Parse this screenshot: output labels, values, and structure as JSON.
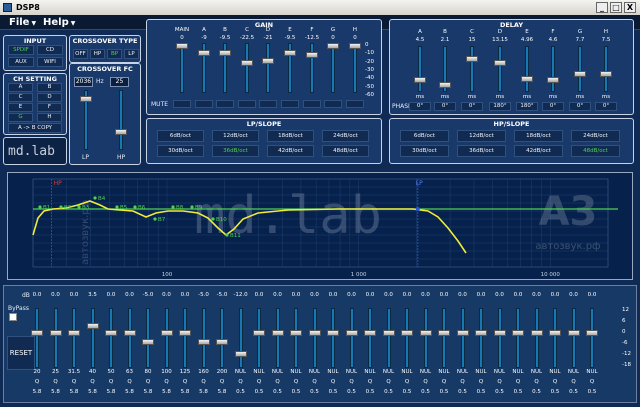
{
  "window": {
    "title": "DSP8",
    "minimize": "_",
    "maximize": "□",
    "close": "X"
  },
  "menu": [
    {
      "label": "File"
    },
    {
      "label": "Help"
    }
  ],
  "input": {
    "title": "INPUT",
    "buttons": [
      "SPDIF",
      "CD",
      "AUX",
      "WIFI"
    ],
    "active": "SPDIF"
  },
  "ch_setting": {
    "title": "CH SETTING",
    "buttons": [
      "A",
      "B",
      "C",
      "D",
      "E",
      "F",
      "G",
      "H"
    ],
    "active": "G",
    "copy": "A -> B COPY"
  },
  "logo": "md.lab",
  "crossover_type": {
    "title": "CROSSOVER TYPE",
    "buttons": [
      "OFF",
      "HP",
      "BP",
      "LP"
    ],
    "active": "BP"
  },
  "crossover_fc": {
    "title": "CROSSOVER FC",
    "lp_value": "2036",
    "hp_value": "25",
    "unit": "Hz",
    "lp_label": "LP",
    "hp_label": "HP",
    "lp_level": 0.85,
    "hp_level": 0.3
  },
  "gain": {
    "title": "GAIN",
    "channels": [
      "MAIN",
      "A",
      "B",
      "C",
      "D",
      "E",
      "F",
      "G",
      "H"
    ],
    "values": [
      "0",
      "-9",
      "-9.5",
      "-22.5",
      "-21",
      "-9.5",
      "-12.5",
      "0",
      "0"
    ],
    "mute_label": "MUTE",
    "scale": [
      "0",
      "-10",
      "-20",
      "-30",
      "-40",
      "-50",
      "-60"
    ]
  },
  "delay": {
    "title": "DELAY",
    "channels": [
      "A",
      "B",
      "C",
      "D",
      "E",
      "F",
      "G",
      "H"
    ],
    "values": [
      "4.5",
      "2.1",
      "15",
      "13.15",
      "4.96",
      "4.6",
      "7.7",
      "7.5"
    ],
    "unit": "ms",
    "phase_label": "PHASE",
    "phases": [
      "0°",
      "0°",
      "0°",
      "180°",
      "180°",
      "0°",
      "0°",
      "0°"
    ]
  },
  "lp_slope": {
    "title": "LP/SLOPE",
    "options": [
      "6dB/oct",
      "12dB/oct",
      "18dB/oct",
      "24dB/oct",
      "30dB/oct",
      "36dB/oct",
      "42dB/oct",
      "48dB/oct"
    ],
    "active": "36dB/oct"
  },
  "hp_slope": {
    "title": "HP/SLOPE",
    "options": [
      "6dB/oct",
      "12dB/oct",
      "18dB/oct",
      "24dB/oct",
      "30dB/oct",
      "36dB/oct",
      "42dB/oct",
      "48dB/oct"
    ],
    "active": "48dB/oct"
  },
  "graph": {
    "markers": [
      "B1",
      "B2",
      "B3",
      "B4",
      "B5",
      "B6",
      "B7",
      "B8",
      "B9",
      "B10",
      "B11"
    ],
    "hp_marker": "HP",
    "lp_marker": "LP",
    "x_ticks": [
      "100",
      "1 000",
      "10 000"
    ],
    "watermark": "md.lab",
    "brand": "A3",
    "brand_sub": "автозвук.рф",
    "brand_side": "автозвук.рф"
  },
  "eq": {
    "db_label": "dB",
    "bypass_label": "ByPass",
    "reset_label": "RESET",
    "q_label": "Q",
    "values": [
      "0.0",
      "0.0",
      "0.0",
      "3.5",
      "0.0",
      "0.0",
      "-5.0",
      "0.0",
      "0.0",
      "-5.0",
      "-5.0",
      "-12.0",
      "0.0",
      "0.0",
      "0.0",
      "0.0",
      "0.0",
      "0.0",
      "0.0",
      "0.0",
      "0.0",
      "0.0",
      "0.0",
      "0.0",
      "0.0",
      "0.0",
      "0.0",
      "0.0",
      "0.0",
      "0.0",
      "0.0"
    ],
    "freqs": [
      "20",
      "25",
      "31.5",
      "40",
      "50",
      "63",
      "80",
      "100",
      "125",
      "160",
      "200",
      "NUL",
      "NUL",
      "NUL",
      "NUL",
      "NUL",
      "NUL",
      "NUL",
      "NUL",
      "NUL",
      "NUL",
      "NUL",
      "NUL",
      "NUL",
      "NUL",
      "NUL",
      "NUL",
      "NUL",
      "NUL",
      "NUL",
      "NUL"
    ],
    "q_values": [
      "5.8",
      "5.8",
      "5.8",
      "5.8",
      "5.8",
      "5.8",
      "5.8",
      "5.8",
      "5.8",
      "5.8",
      "5.8",
      "0.5",
      "0.5",
      "0.5",
      "0.5",
      "0.5",
      "0.5",
      "0.5",
      "0.5",
      "0.5",
      "0.5",
      "0.5",
      "0.5",
      "0.5",
      "0.5",
      "0.5",
      "0.5",
      "0.5",
      "0.5",
      "0.5",
      "0.5"
    ],
    "scale": [
      "12",
      "6",
      "0",
      "-6",
      "-12",
      "-18"
    ]
  }
}
